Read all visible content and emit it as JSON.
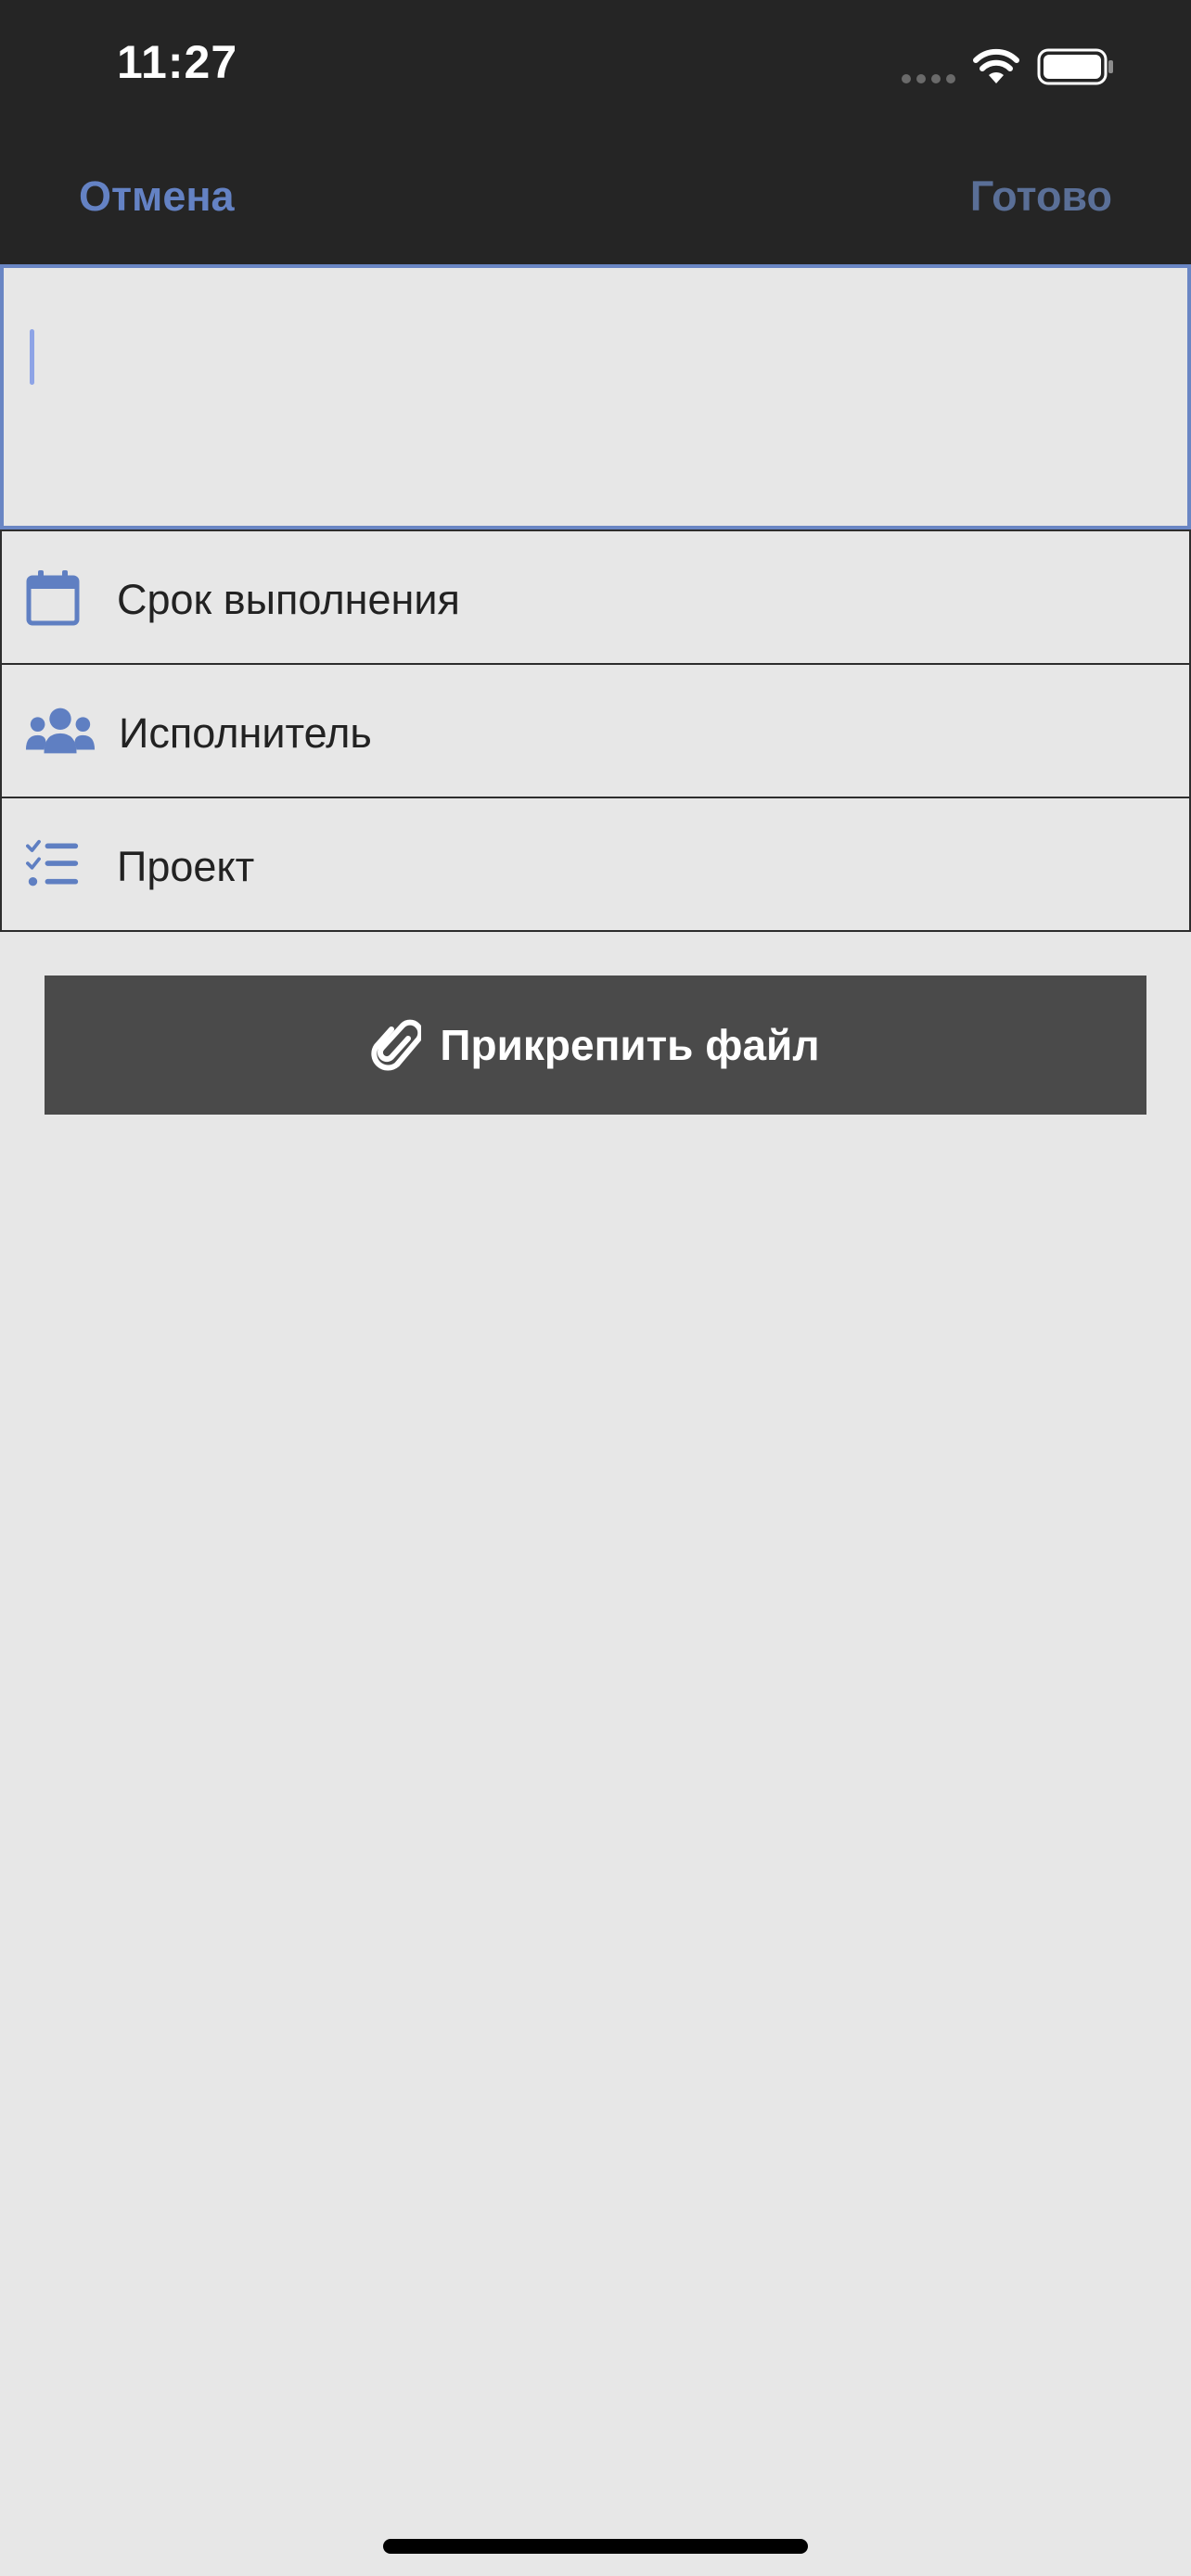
{
  "status_bar": {
    "time": "11:27",
    "signal_icon": "cellular-signal-icon",
    "wifi_icon": "wifi-icon",
    "battery_icon": "battery-icon"
  },
  "nav": {
    "cancel_label": "Отмена",
    "done_label": "Готово"
  },
  "task_input": {
    "value": ""
  },
  "rows": [
    {
      "icon": "calendar-icon",
      "label": "Срок выполнения"
    },
    {
      "icon": "users-icon",
      "label": "Исполнитель"
    },
    {
      "icon": "checklist-icon",
      "label": "Проект"
    }
  ],
  "attach_button": {
    "icon": "paperclip-icon",
    "label": "Прикрепить файл"
  },
  "colors": {
    "accent": "#6482c4",
    "topbar": "#252525",
    "background": "#e7e7e7",
    "button": "#4a4a4a"
  }
}
